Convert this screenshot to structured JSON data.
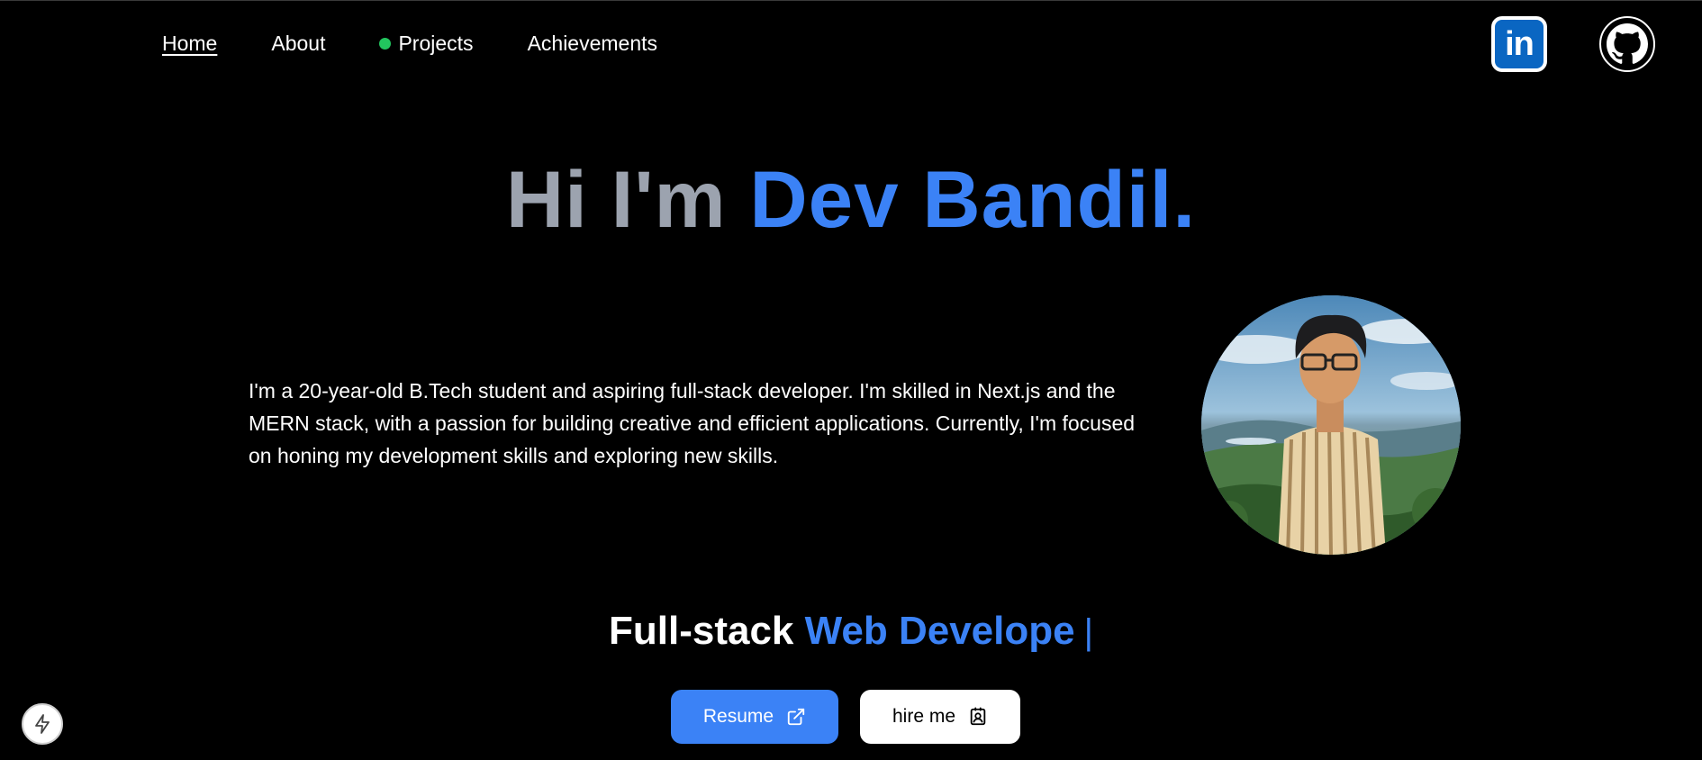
{
  "nav": {
    "items": [
      {
        "label": "Home"
      },
      {
        "label": "About"
      },
      {
        "label": "Projects"
      },
      {
        "label": "Achievements"
      }
    ],
    "active": "Home",
    "projects_dot_color": "#22c55e"
  },
  "social": {
    "linkedin_icon": "linkedin-icon",
    "linkedin_text": "in",
    "github_icon": "github-icon"
  },
  "hero": {
    "greeting": "Hi I'm ",
    "name": "Dev Bandil."
  },
  "bio": "I'm a 20-year-old B.Tech student and aspiring full-stack developer. I'm skilled in Next.js and the MERN stack, with a passion for building creative and efficient applications. Currently, I'm focused on honing my development skills and exploring new skills.",
  "role": {
    "prefix": "Full-stack ",
    "typed": "Web Develope",
    "cursor": "|"
  },
  "buttons": {
    "resume": "Resume",
    "resume_icon": "external-link-icon",
    "hire": "hire me",
    "hire_icon": "contact-icon"
  },
  "colors": {
    "accent": "#3b82f6",
    "grey_text": "#9ca3af",
    "background": "#000000"
  }
}
